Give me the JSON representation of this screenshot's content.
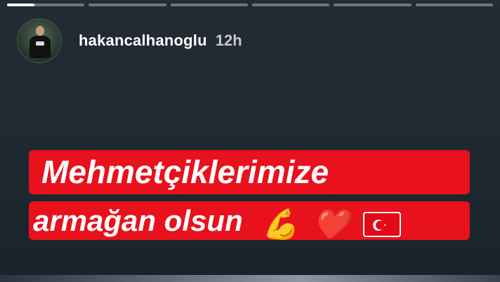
{
  "story": {
    "segments": [
      {
        "progress": 0.35
      },
      {
        "progress": 0
      },
      {
        "progress": 0
      },
      {
        "progress": 0
      },
      {
        "progress": 0
      },
      {
        "progress": 0
      }
    ]
  },
  "header": {
    "username": "hakancalhanoglu",
    "time": "12h",
    "avatar_icon": "profile-photo-icon"
  },
  "content": {
    "line1": "Mehmetçiklerimize",
    "line2": "armağan olsun",
    "emoji_muscle": "💪",
    "emoji_heart": "❤️",
    "flag_icon": "turkey-flag-icon",
    "banner_color": "#e8111c"
  }
}
